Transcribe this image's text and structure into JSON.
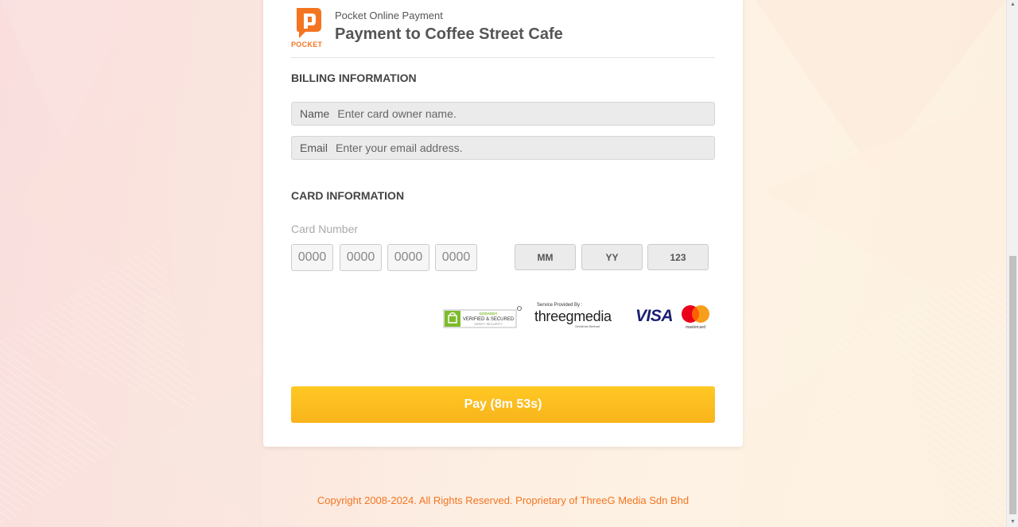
{
  "header": {
    "logo_text": "POCKET",
    "subtitle": "Pocket Online Payment",
    "title": "Payment to Coffee Street Cafe"
  },
  "billing": {
    "section_title": "BILLING INFORMATION",
    "name_label": "Name",
    "name_placeholder": "Enter card owner name.",
    "email_label": "Email",
    "email_placeholder": "Enter your email address."
  },
  "card": {
    "section_title": "CARD INFORMATION",
    "number_label": "Card Number",
    "number_placeholders": [
      "0000",
      "0000",
      "0000",
      "0000"
    ],
    "month_placeholder": "MM",
    "year_placeholder": "YY",
    "cvv_placeholder": "123"
  },
  "badges": {
    "godaddy_top": "GODADDY",
    "godaddy_main": "VERIFIED & SECURED",
    "godaddy_sub": "VERIFY SECURITY",
    "service_label": "Service Provided By :",
    "threeg_name": "threegmedia",
    "threeg_sub": "Sendirian Berhad",
    "visa": "VISA",
    "mastercard": "mastercard"
  },
  "pay_button": "Pay (8m 53s)",
  "footer": {
    "copyright": "Copyright 2008-2024. All Rights Reserved. Proprietary of ThreeG Media Sdn Bhd"
  },
  "colors": {
    "brand_orange": "#f47521",
    "pay_yellow": "#fbbf1f",
    "visa_blue": "#1a1f71"
  }
}
